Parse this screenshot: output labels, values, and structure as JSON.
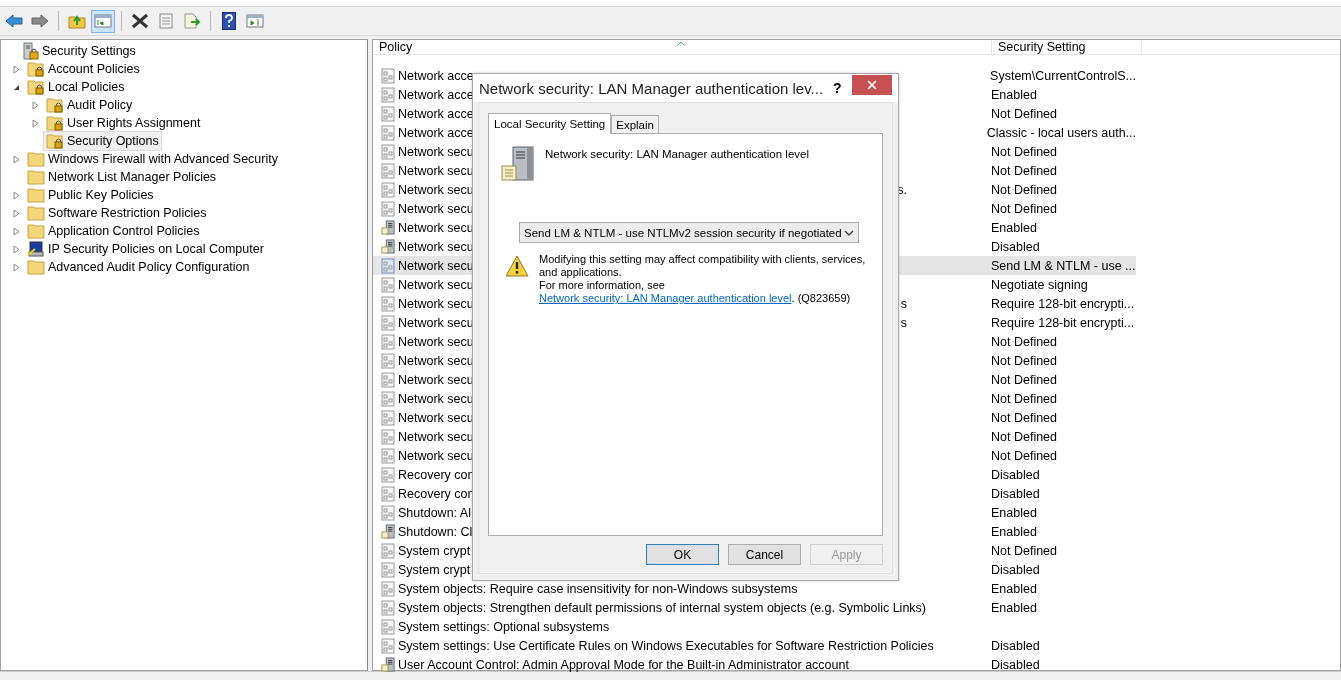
{
  "toolbar": [
    {
      "kind": "back",
      "pressed": false
    },
    {
      "kind": "forward",
      "pressed": false
    },
    {
      "kind": "separator"
    },
    {
      "kind": "up",
      "pressed": false
    },
    {
      "kind": "tree-toggle",
      "pressed": true
    },
    {
      "kind": "separator"
    },
    {
      "kind": "delete",
      "pressed": false
    },
    {
      "kind": "properties",
      "pressed": false
    },
    {
      "kind": "export",
      "pressed": false
    },
    {
      "kind": "separator"
    },
    {
      "kind": "help",
      "pressed": false
    },
    {
      "kind": "action-pane",
      "pressed": false
    }
  ],
  "tree": {
    "label": "Security Settings",
    "kind": "root",
    "selected": false,
    "children": [
      {
        "label": "Account Policies",
        "kind": "locked-folder",
        "expanded": false,
        "selected": false
      },
      {
        "label": "Local Policies",
        "kind": "locked-folder",
        "expanded": true,
        "selected": false,
        "children": [
          {
            "label": "Audit Policy",
            "kind": "locked-folder",
            "expanded": false,
            "selected": false
          },
          {
            "label": "User Rights Assignment",
            "kind": "locked-folder",
            "expanded": false,
            "selected": false
          },
          {
            "label": "Security Options",
            "kind": "locked-folder",
            "selected": true
          }
        ]
      },
      {
        "label": "Windows Firewall with Advanced Security",
        "kind": "folder",
        "expanded": false,
        "selected": false
      },
      {
        "label": "Network List Manager Policies",
        "kind": "folder",
        "selected": false
      },
      {
        "label": "Public Key Policies",
        "kind": "folder",
        "expanded": false,
        "selected": false
      },
      {
        "label": "Software Restriction Policies",
        "kind": "folder",
        "expanded": false,
        "selected": false
      },
      {
        "label": "Application Control Policies",
        "kind": "folder",
        "expanded": false,
        "selected": false
      },
      {
        "label": "IP Security Policies on Local Computer",
        "kind": "computer",
        "expanded": false,
        "selected": false
      },
      {
        "label": "Advanced Audit Policy Configuration",
        "kind": "folder",
        "expanded": false,
        "selected": false
      }
    ]
  },
  "table": {
    "columns": [
      "Policy",
      "Security Setting"
    ],
    "rows": [
      {
        "policy": "Network acce",
        "setting": "System\\CurrentControlS...",
        "kind": "policy",
        "selected": false
      },
      {
        "policy": "Network acce",
        "setting": "Enabled",
        "kind": "policy",
        "selected": false
      },
      {
        "policy": "Network acce",
        "setting": "Not Defined",
        "kind": "policy",
        "selected": false
      },
      {
        "policy": "Network acce",
        "setting": "Classic - local users auth...",
        "kind": "policy",
        "selected": false
      },
      {
        "policy": "Network secu",
        "setting": "Not Defined",
        "kind": "policy",
        "selected": false
      },
      {
        "policy": "Network secu",
        "setting": "Not Defined",
        "kind": "policy",
        "selected": false
      },
      {
        "policy": "Network secu",
        "tail": "s.",
        "setting": "Not Defined",
        "kind": "policy",
        "selected": false
      },
      {
        "policy": "Network secu",
        "setting": "Not Defined",
        "kind": "policy",
        "selected": false
      },
      {
        "policy": "Network secu",
        "setting": "Enabled",
        "kind": "server",
        "selected": false
      },
      {
        "policy": "Network secu",
        "setting": "Disabled",
        "kind": "server",
        "selected": false
      },
      {
        "policy": "Network secu",
        "setting": "Send LM & NTLM - use ...",
        "kind": "policy",
        "selected": true
      },
      {
        "policy": "Network secu",
        "setting": "Negotiate signing",
        "kind": "policy",
        "selected": false
      },
      {
        "policy": "Network secu",
        "tail": "s",
        "setting": "Require 128-bit encrypti...",
        "kind": "policy",
        "selected": false
      },
      {
        "policy": "Network secu",
        "tail": "s",
        "setting": "Require 128-bit encrypti...",
        "kind": "policy",
        "selected": false
      },
      {
        "policy": "Network secu",
        "setting": "Not Defined",
        "kind": "policy",
        "selected": false
      },
      {
        "policy": "Network secu",
        "setting": "Not Defined",
        "kind": "policy",
        "selected": false
      },
      {
        "policy": "Network secu",
        "setting": "Not Defined",
        "kind": "policy",
        "selected": false
      },
      {
        "policy": "Network secu",
        "setting": "Not Defined",
        "kind": "policy",
        "selected": false
      },
      {
        "policy": "Network secu",
        "setting": "Not Defined",
        "kind": "policy",
        "selected": false
      },
      {
        "policy": "Network secu",
        "setting": "Not Defined",
        "kind": "policy",
        "selected": false
      },
      {
        "policy": "Network secu",
        "setting": "Not Defined",
        "kind": "policy",
        "selected": false
      },
      {
        "policy": "Recovery con",
        "setting": "Disabled",
        "kind": "policy",
        "selected": false
      },
      {
        "policy": "Recovery con",
        "setting": "Disabled",
        "kind": "policy",
        "selected": false
      },
      {
        "policy": "Shutdown: Al",
        "setting": "Enabled",
        "kind": "policy",
        "selected": false
      },
      {
        "policy": "Shutdown: Cl",
        "setting": "Enabled",
        "kind": "server",
        "selected": false
      },
      {
        "policy": "System crypt",
        "setting": "Not Defined",
        "kind": "policy",
        "selected": false
      },
      {
        "policy": "System crypt",
        "setting": "Disabled",
        "kind": "policy",
        "selected": false
      },
      {
        "policy": "System objects: Require case insensitivity for non-Windows subsystems",
        "setting": "Enabled",
        "kind": "policy",
        "selected": false
      },
      {
        "policy": "System objects: Strengthen default permissions of internal system objects (e.g. Symbolic Links)",
        "setting": "Enabled",
        "kind": "policy",
        "selected": false
      },
      {
        "policy": "System settings: Optional subsystems",
        "kind": "policy",
        "selected": false
      },
      {
        "policy": "System settings: Use Certificate Rules on Windows Executables for Software Restriction Policies",
        "setting": "Disabled",
        "kind": "policy",
        "selected": false
      },
      {
        "policy": "User Account Control: Admin Approval Mode for the Built-in Administrator account",
        "setting": "Disabled",
        "kind": "server",
        "selected": false
      }
    ]
  },
  "dialog": {
    "title": "Network security: LAN Manager authentication lev...",
    "help": "?",
    "tabs": [
      {
        "label": "Local Security Setting",
        "selected": true
      },
      {
        "label": "Explain",
        "selected": false
      }
    ],
    "policy_name": "Network security: LAN Manager authentication level",
    "dropdown": {
      "value": "Send LM & NTLM - use NTLMv2 session security if negotiated"
    },
    "warning": "Modifying this setting may affect compatibility with clients, services, and applications.",
    "info_before": "For more information, see",
    "info_link": "Network security: LAN Manager authentication level",
    "info_after": ". (Q823659)",
    "buttons": [
      {
        "label": "OK",
        "default": true,
        "disabled": false
      },
      {
        "label": "Cancel",
        "default": false,
        "disabled": false
      },
      {
        "label": "Apply",
        "default": false,
        "disabled": true
      }
    ]
  }
}
